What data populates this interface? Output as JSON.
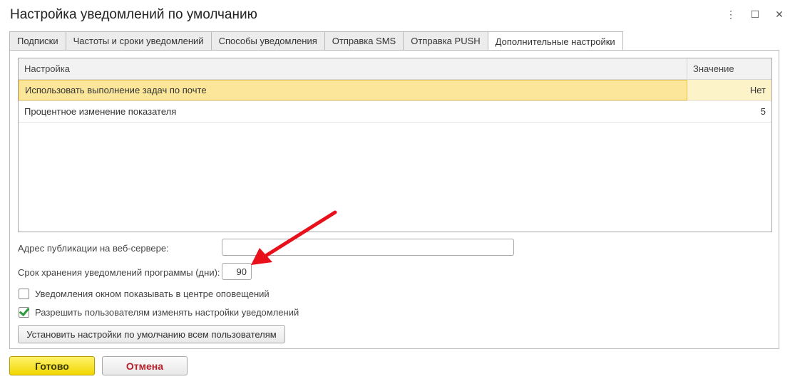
{
  "window": {
    "title": "Настройка уведомлений по умолчанию",
    "controls": {
      "menu": "⋮",
      "maximize": "☐",
      "close": "✕"
    }
  },
  "tabs": [
    {
      "label": "Подписки"
    },
    {
      "label": "Частоты и сроки уведомлений"
    },
    {
      "label": "Способы уведомления"
    },
    {
      "label": "Отправка SMS"
    },
    {
      "label": "Отправка PUSH"
    },
    {
      "label": "Дополнительные настройки",
      "active": true
    }
  ],
  "settings_table": {
    "columns": [
      "Настройка",
      "Значение"
    ],
    "rows": [
      {
        "name": "Использовать выполнение задач по почте",
        "value": "Нет",
        "selected": true
      },
      {
        "name": "Процентное изменение показателя",
        "value": "5"
      }
    ]
  },
  "form": {
    "publish_address_label": "Адрес публикации на веб-сервере:",
    "publish_address_value": "",
    "retention_label": "Срок хранения уведомлений программы (дни):",
    "retention_value": "90",
    "checkbox_center": {
      "label": "Уведомления окном показывать в центре оповещений",
      "checked": false
    },
    "checkbox_allow": {
      "label": "Разрешить пользователям изменять настройки уведомлений",
      "checked": true
    },
    "apply_defaults_button": "Установить настройки по умолчанию всем пользователям"
  },
  "footer": {
    "ok_label": "Готово",
    "cancel_label": "Отмена"
  },
  "colors": {
    "selected_row": "#fbe69a",
    "ok_button": "#f0d600",
    "cancel_text": "#b3222a",
    "annotation_arrow": "#e8101a"
  }
}
